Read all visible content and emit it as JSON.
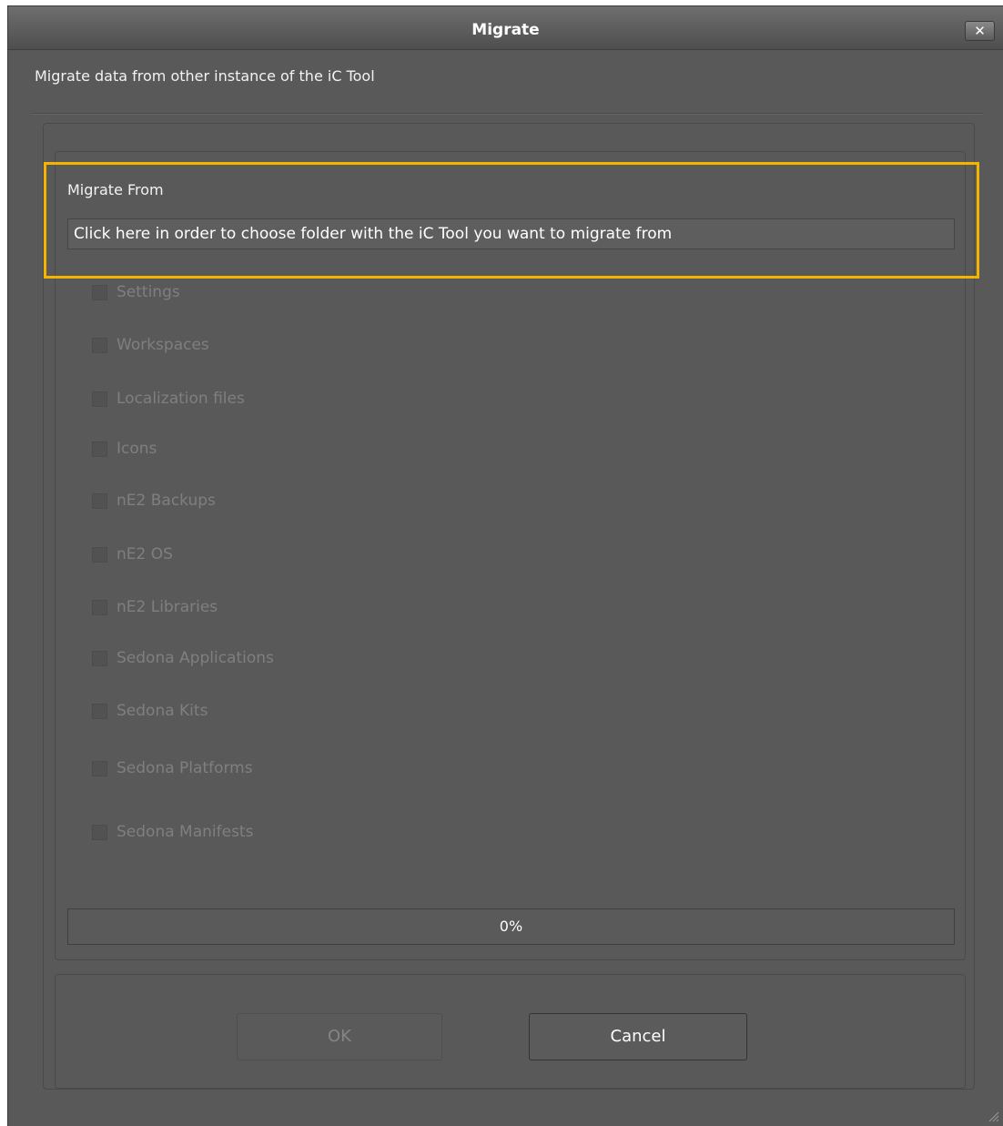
{
  "window": {
    "title": "Migrate",
    "close_label": "✕"
  },
  "subtitle": "Migrate data from other instance of the iC Tool",
  "migrate_from": {
    "label": "Migrate From",
    "field_value": "Click here in order to choose folder with the iC Tool you want to migrate from"
  },
  "options": [
    {
      "label": "Settings",
      "checked": false,
      "enabled": false
    },
    {
      "label": "Workspaces",
      "checked": false,
      "enabled": false
    },
    {
      "label": "Localization files",
      "checked": false,
      "enabled": false
    },
    {
      "label": "Icons",
      "checked": false,
      "enabled": false
    },
    {
      "label": "nE2 Backups",
      "checked": false,
      "enabled": false
    },
    {
      "label": "nE2 OS",
      "checked": false,
      "enabled": false
    },
    {
      "label": "nE2 Libraries",
      "checked": false,
      "enabled": false
    },
    {
      "label": "Sedona Applications",
      "checked": false,
      "enabled": false
    },
    {
      "label": "Sedona Kits",
      "checked": false,
      "enabled": false
    },
    {
      "label": "Sedona Platforms",
      "checked": false,
      "enabled": false
    },
    {
      "label": "Sedona Manifests",
      "checked": false,
      "enabled": false
    }
  ],
  "progress": {
    "value": 0,
    "label": "0%"
  },
  "buttons": {
    "ok_label": "OK",
    "cancel_label": "Cancel"
  },
  "colors": {
    "highlight": "#f5b400",
    "window_bg": "#595959"
  }
}
